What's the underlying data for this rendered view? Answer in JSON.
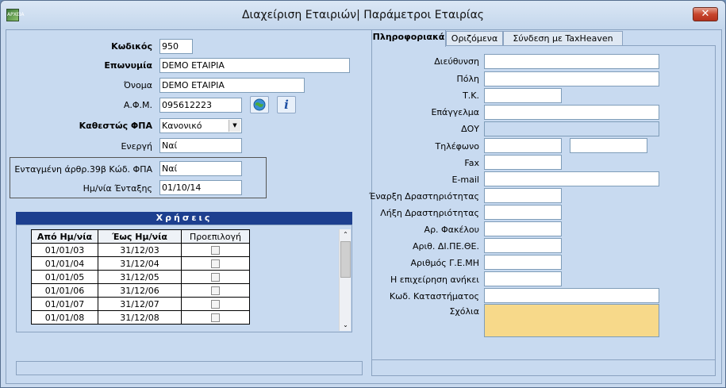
{
  "window": {
    "title": "Διαχείριση Εταιριών| Παράμετροι Εταιρίας",
    "close_glyph": "✕",
    "app_icon_label": "ΑΡΧΕΙΑ"
  },
  "left": {
    "code_label": "Κωδικός",
    "code_value": "950",
    "name_label": "Επωνυμία",
    "name_value": "DEMO ΕΤΑΙΡΙΑ",
    "short_label": "Όνομα",
    "short_value": "DEMO ΕΤΑΙΡΙΑ",
    "afm_label": "Α.Φ.Μ.",
    "afm_value": "095612223",
    "vat_label": "Καθεστώς ΦΠΑ",
    "vat_value": "Κανονικό",
    "active_label": "Ενεργή",
    "active_value": "Ναί",
    "art39_label": "Ενταγμένη άρθρ.39β Κώδ. ΦΠΑ",
    "art39_value": "Ναί",
    "join_date_label": "Ημ/νία Ένταξης",
    "join_date_value": "01/10/14"
  },
  "uses": {
    "header": "Χρήσεις",
    "columns": [
      "Από Ημ/νία",
      "Έως Ημ/νία",
      "Προεπιλογή"
    ],
    "rows": [
      {
        "from": "01/01/03",
        "to": "31/12/03"
      },
      {
        "from": "01/01/04",
        "to": "31/12/04"
      },
      {
        "from": "01/01/05",
        "to": "31/12/05"
      },
      {
        "from": "01/01/06",
        "to": "31/12/06"
      },
      {
        "from": "01/01/07",
        "to": "31/12/07"
      },
      {
        "from": "01/01/08",
        "to": "31/12/08"
      }
    ]
  },
  "tabs": [
    "Πληροφοριακά",
    "Οριζόμενα",
    "Σύνδεση με TaxHeaven"
  ],
  "info": {
    "address_label": "Διεύθυνση",
    "city_label": "Πόλη",
    "zip_label": "Τ.Κ.",
    "profession_label": "Επάγγελμα",
    "doy_label": "ΔΟΥ",
    "phone_label": "Τηλέφωνο",
    "fax_label": "Fax",
    "email_label": "E-mail",
    "start_label": "Έναρξη Δραστηριότητας",
    "end_label": "Λήξη Δραστηριότητας",
    "folder_label": "Αρ. Φακέλου",
    "dipethe_label": "Αριθ. ΔΙ.ΠΕ.ΘΕ.",
    "gemi_label": "Αριθμός Γ.Ε.ΜΗ",
    "belongs_label": "Η επιχείρηση ανήκει",
    "store_label": "Κωδ. Καταστήματος",
    "notes_label": "Σχόλια"
  },
  "icons": {
    "dropdown": "▼",
    "scroll_up": "⌃",
    "scroll_down": "⌄",
    "info_glyph": "i"
  }
}
